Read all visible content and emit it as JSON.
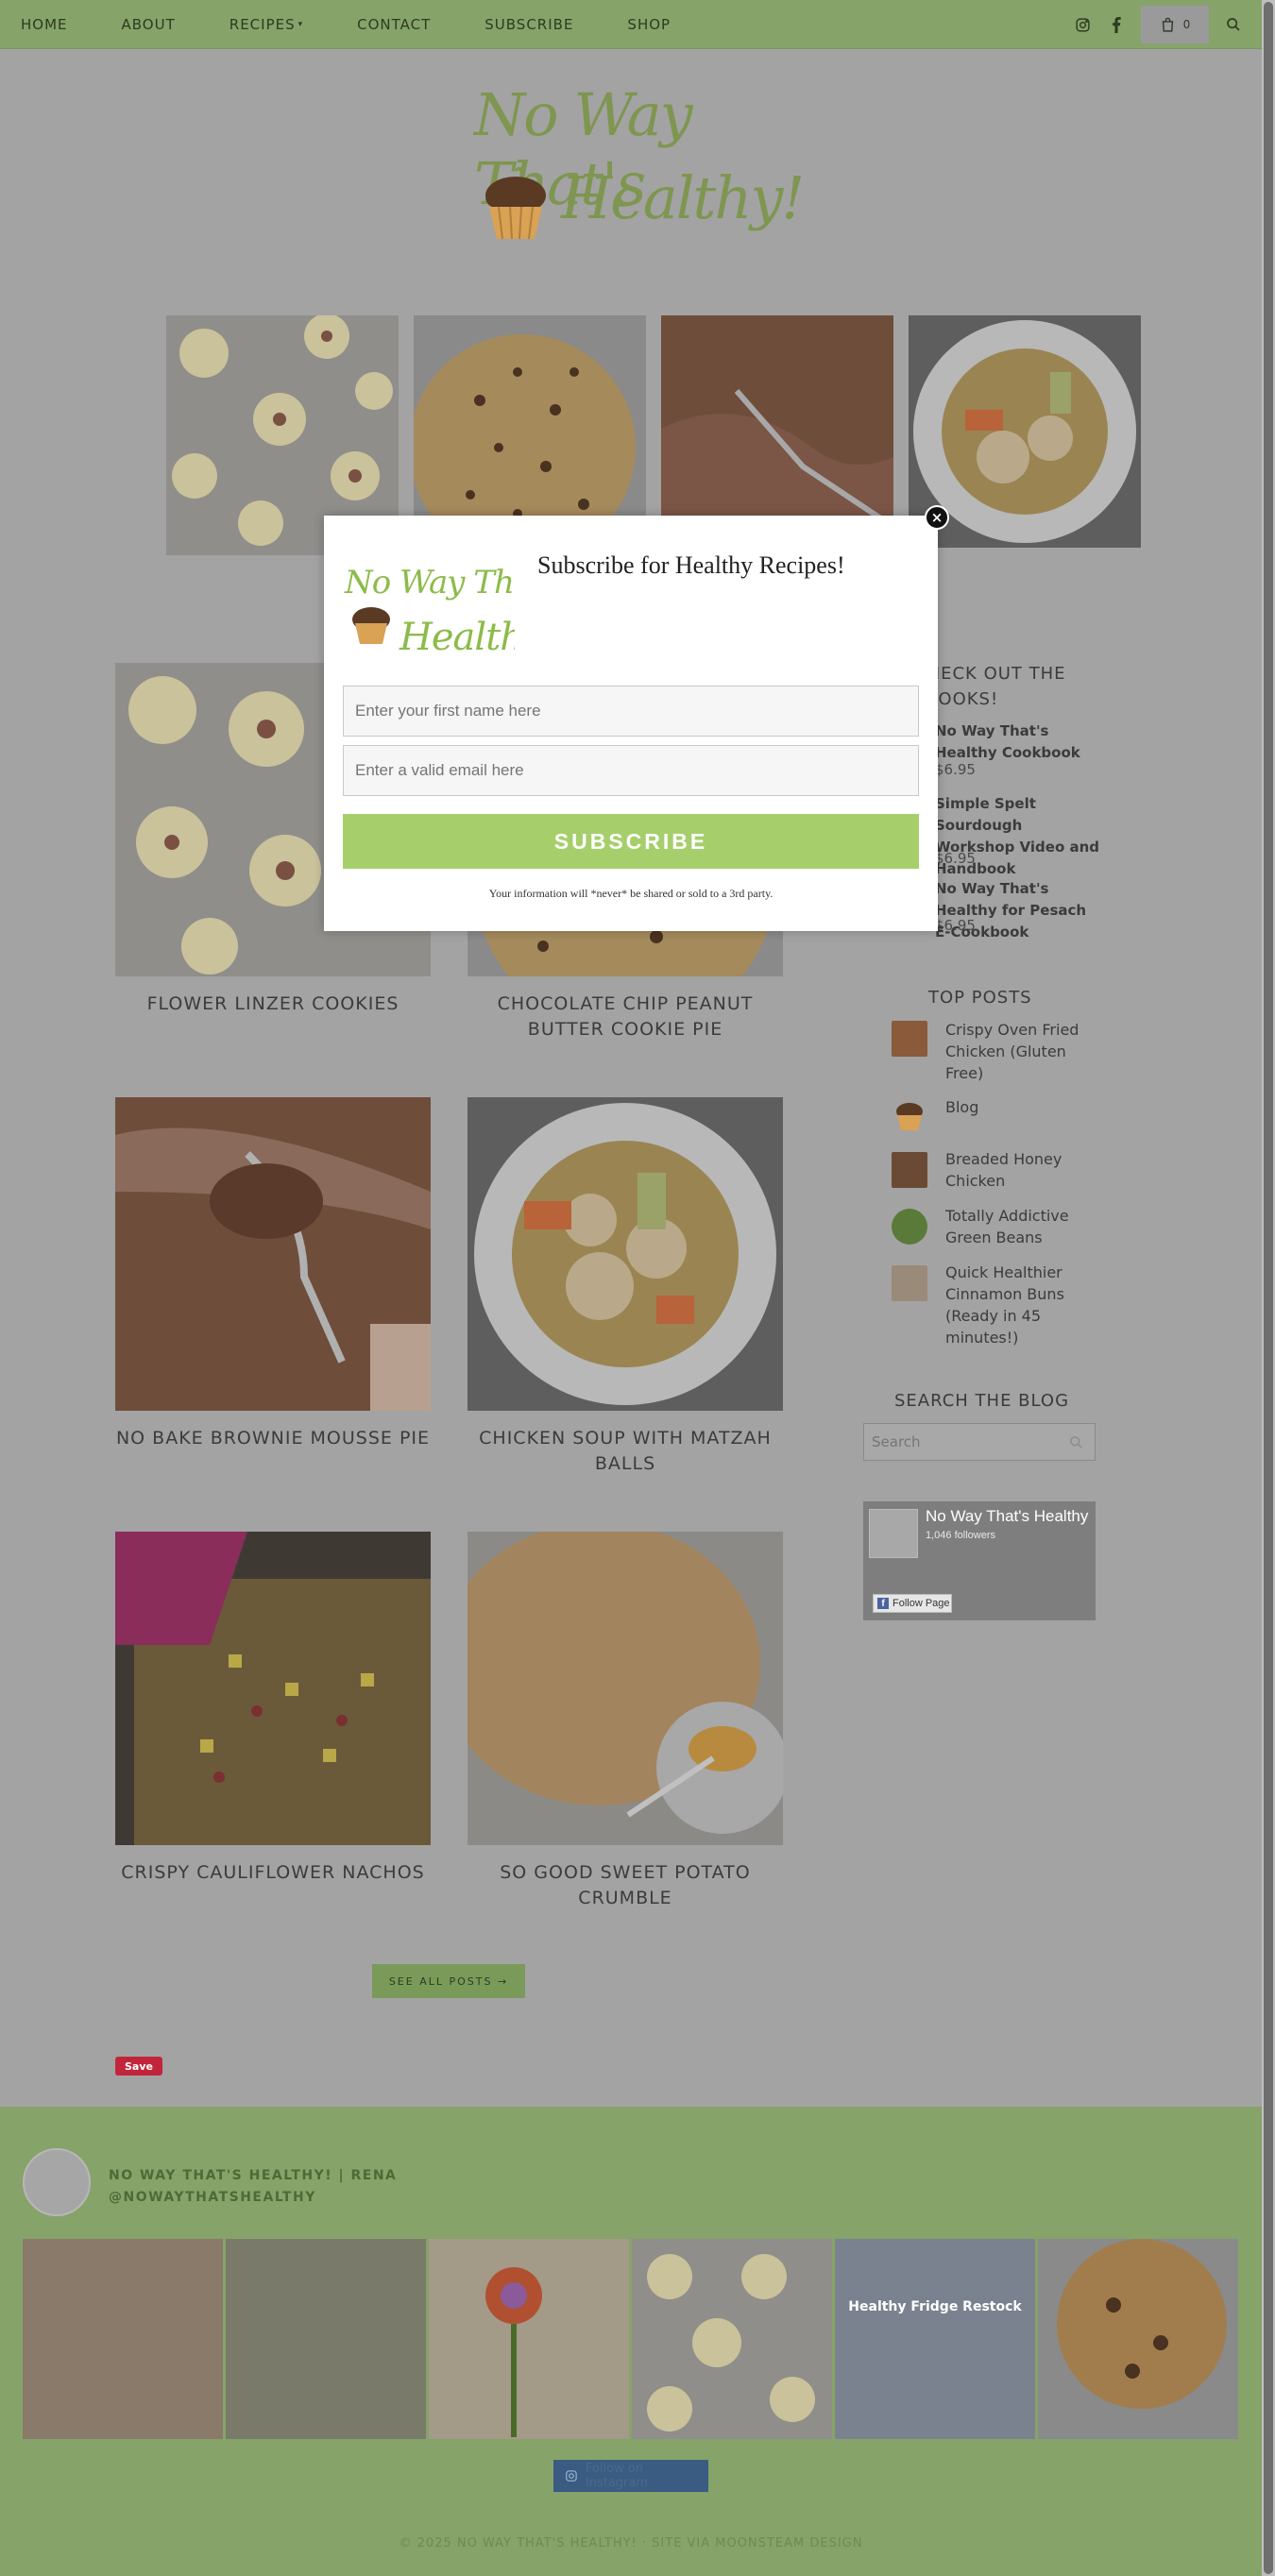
{
  "nav": {
    "items": [
      "HOME",
      "ABOUT",
      "RECIPES",
      "CONTACT",
      "SUBSCRIBE",
      "SHOP"
    ],
    "cart_count": "0"
  },
  "brand": {
    "line1": "No Way That's",
    "line2": "Healthy!"
  },
  "posts": [
    {
      "title": "FLOWER LINZER COOKIES"
    },
    {
      "title": "CHOCOLATE CHIP PEANUT BUTTER COOKIE PIE"
    },
    {
      "title": "NO BAKE BROWNIE MOUSSE PIE"
    },
    {
      "title": "CHICKEN SOUP WITH MATZAH BALLS"
    },
    {
      "title": "CRISPY CAULIFLOWER NACHOS"
    },
    {
      "title": "SO GOOD SWEET POTATO CRUMBLE"
    }
  ],
  "see_all": "SEE ALL POSTS →",
  "pin_save": "Save",
  "sidebar": {
    "ebooks_heading": "CHECK OUT THE EBOOKS!",
    "ebooks": [
      {
        "title": "No Way That's Healthy Cookbook",
        "price": "$6.95"
      },
      {
        "title": "Simple Spelt Sourdough Workshop Video and Handbook",
        "price": "$6.95"
      },
      {
        "title": "No Way That's Healthy for Pesach E-Cookbook",
        "price": "$6.95"
      }
    ],
    "top_posts_heading": "TOP POSTS",
    "top_posts": [
      "Crispy Oven Fried Chicken (Gluten Free)",
      "Blog",
      "Breaded Honey Chicken",
      "Totally Addictive Green Beans",
      "Quick Healthier Cinnamon Buns (Ready in 45 minutes!)"
    ],
    "search_heading": "SEARCH THE BLOG",
    "search_placeholder": "Search",
    "fb": {
      "name": "No Way That's Healthy",
      "followers": "1,046 followers",
      "button": "Follow Page"
    }
  },
  "instagram": {
    "name_line1": "NO WAY THAT'S HEALTHY! | RENA",
    "name_line2": "@NOWAYTHATSHEALTHY",
    "tile_caption": "Healthy Fridge Restock",
    "follow_button": "Follow on Instagram"
  },
  "copyright": "© 2025 NO WAY THAT'S HEALTHY! · SITE VIA MOONSTEAM DESIGN",
  "modal": {
    "title": "Subscribe for Healthy Recipes!",
    "name_placeholder": "Enter your first name here",
    "email_placeholder": "Enter a valid email here",
    "button": "SUBSCRIBE",
    "note": "Your information will *never* be shared or sold to a 3rd party.",
    "close": "×"
  },
  "colors": {
    "nav_green": "#86a36a",
    "subscribe_green": "#a6cf6b",
    "overlay_gray": "#a3a3a3"
  }
}
